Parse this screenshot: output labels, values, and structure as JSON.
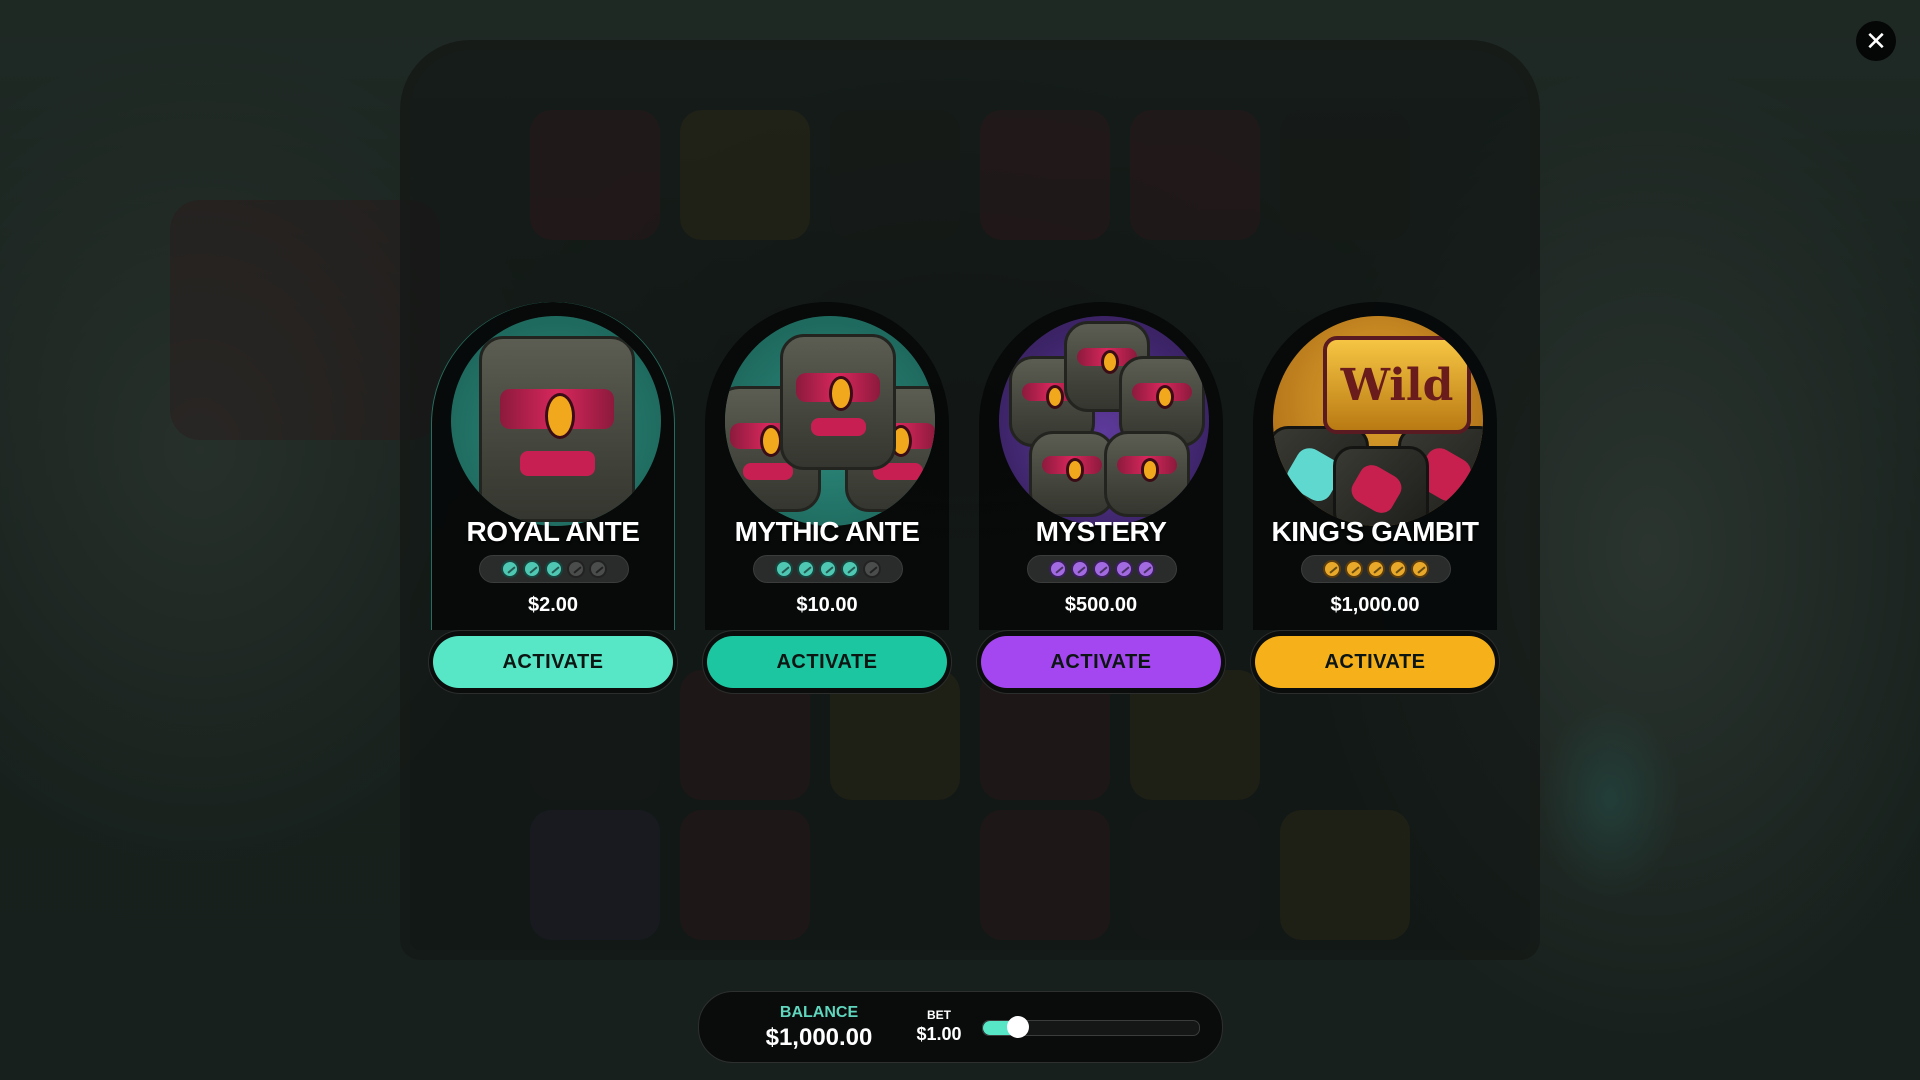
{
  "colors": {
    "royal": "#57e6c6",
    "mythic": "#1cc6a1",
    "mystery": "#a447f0",
    "kings": "#f6b01a",
    "balance_label": "#5fd6bd"
  },
  "close_button": {
    "icon": "close-icon",
    "glyph": "✕"
  },
  "cards": [
    {
      "title": "ROYAL ANTE",
      "price": "$2.00",
      "button_label": "ACTIVATE",
      "level": 3,
      "max_level": 5,
      "theme": "teal"
    },
    {
      "title": "MYTHIC ANTE",
      "price": "$10.00",
      "button_label": "ACTIVATE",
      "level": 4,
      "max_level": 5,
      "theme": "teal"
    },
    {
      "title": "MYSTERY",
      "price": "$500.00",
      "button_label": "ACTIVATE",
      "level": 5,
      "max_level": 5,
      "theme": "purple"
    },
    {
      "title": "KING'S GAMBIT",
      "price": "$1,000.00",
      "button_label": "ACTIVATE",
      "level": 5,
      "max_level": 5,
      "theme": "gold"
    }
  ],
  "wild_symbol_text": "Wild",
  "footer": {
    "balance_label": "BALANCE",
    "balance_value": "$1,000.00",
    "bet_label": "BET",
    "bet_value": "$1.00",
    "bet_slider_level": 0.16
  }
}
